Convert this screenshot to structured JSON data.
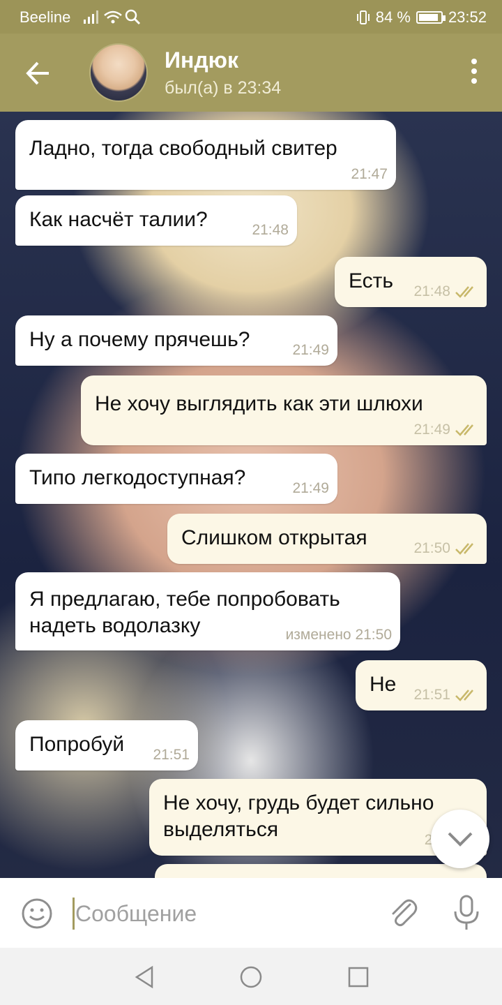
{
  "status_bar": {
    "carrier": "Beeline",
    "battery": "84 %",
    "time": "23:52"
  },
  "header": {
    "contact_name": "Индюк",
    "contact_status": "был(а) в 23:34"
  },
  "messages": [
    {
      "dir": "in",
      "text": "Ладно, тогда свободный свитер",
      "time": "21:47"
    },
    {
      "dir": "in",
      "text": "Как насчёт талии?",
      "time": "21:48"
    },
    {
      "dir": "out",
      "text": "Есть",
      "time": "21:48"
    },
    {
      "dir": "in",
      "text": "Ну а почему прячешь?",
      "time": "21:49"
    },
    {
      "dir": "out",
      "text": "Не хочу выглядить как эти шлюхи",
      "time": "21:49"
    },
    {
      "dir": "in",
      "text": "Типо легкодоступная?",
      "time": "21:49"
    },
    {
      "dir": "out",
      "text": "Слишком открытая",
      "time": "21:50"
    },
    {
      "dir": "in",
      "text": "Я предлагаю, тебе попробовать\nнадеть водолазку",
      "time": "изменено 21:50"
    },
    {
      "dir": "out",
      "text": "Не",
      "time": "21:51"
    },
    {
      "dir": "in",
      "text": "Попробуй",
      "time": "21:51"
    },
    {
      "dir": "out",
      "text": "Не хочу, грудь будет сильно\nвыделяться",
      "time": "21:"
    }
  ],
  "input": {
    "placeholder": "Сообщение"
  },
  "icons": {
    "back": "arrow-left-icon",
    "menu": "more-vertical-icon",
    "emoji": "smile-icon",
    "attach": "paperclip-icon",
    "mic": "microphone-icon",
    "scroll_down": "chevron-down-icon",
    "read_receipt": "double-check-icon"
  },
  "colors": {
    "header": "#a39b5f",
    "status_bar": "#9c9458",
    "incoming_bubble": "#ffffff",
    "outgoing_bubble": "#fcf7e6",
    "check_color": "#c8b86a"
  }
}
